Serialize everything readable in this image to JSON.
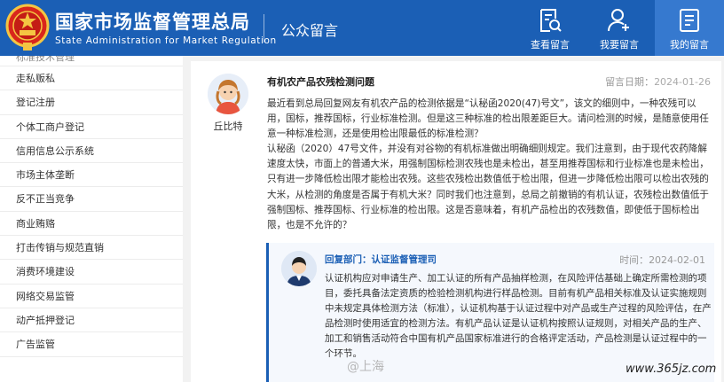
{
  "header": {
    "title": "国家市场监督管理总局",
    "subtitle": "State Administration for Market Regulation",
    "section": "公众留言",
    "nav": [
      {
        "label": "查看留言",
        "icon": "search-document-icon"
      },
      {
        "label": "我要留言",
        "icon": "user-add-icon"
      },
      {
        "label": "我的留言",
        "icon": "message-list-icon"
      }
    ],
    "colors": {
      "brand": "#1b5fb5",
      "active_nav": "#3679cf"
    }
  },
  "sidebar": {
    "items": [
      {
        "label": "标准技术管理"
      },
      {
        "label": "走私贩私"
      },
      {
        "label": "登记注册"
      },
      {
        "label": "个体工商户登记"
      },
      {
        "label": "信用信息公示系统"
      },
      {
        "label": "市场主体垄断"
      },
      {
        "label": "反不正当竞争"
      },
      {
        "label": "商业贿赂"
      },
      {
        "label": "打击传销与规范直销"
      },
      {
        "label": "消费环境建设"
      },
      {
        "label": "网络交易监管"
      },
      {
        "label": "动产抵押登记"
      },
      {
        "label": "广告监管"
      }
    ]
  },
  "message": {
    "author": "丘比特",
    "title": "有机农产品农残检测问题",
    "time_label": "留言日期：",
    "time": "2024-01-26",
    "paragraphs": [
      "最近看到总局回复网友有机农产品的检测依据是“认秘函2020(47)号文”，该文的细则中，一种农残可以用，国标，推荐国标，行业标准检测。但是这三种标准的检出限差距巨大。请问检测的时候，是随意使用任意一种标准检测，还是使用检出限最低的标准检测？",
      "认秘函（2020）47号文件，并没有对谷物的有机标准做出明确细则规定。我们注意到，由于现代农药降解速度太快，市面上的普通大米，用强制国标检测农残也是未检出，甚至用推荐国标和行业标准也是未检出，只有进一步降低检出限才能检出农残。这些农残检出数值低于检出限，但进一步降低检出限可以检出农残的大米，从检测的角度是否属于有机大米？同时我们也注意到，总局之前撤销的有机认证，农残检出数值低于强制国标、推荐国标、行业标准的检出限。这是否意味着，有机产品检出的农残数值，即使低于国标检出限，也是不允许的？"
    ]
  },
  "reply": {
    "department_label": "回复部门：",
    "department": "认证监督管理司",
    "time_label": "时间：",
    "time": "2024-02-01",
    "body": "认证机构应对申请生产、加工认证的所有产品抽样检测，在风险评估基础上确定所需检测的项目，委托具备法定资质的检验检测机构进行样品检测。目前有机产品相关标准及认证实施规则中未规定具体检测方法（标准），认证机构基于认证过程中对产品或生产过程的风险评估，在产品检测时使用适宜的检测方法。有机产品认证是认证机构按照认证规则，对相关产品的生产、加工和销售活动符合中国有机产品国家标准进行的合格评定活动，产品检测是认证过程中的一个环节。"
  },
  "watermarks": {
    "weibo": "@上海",
    "site": "www.365jz.com"
  }
}
